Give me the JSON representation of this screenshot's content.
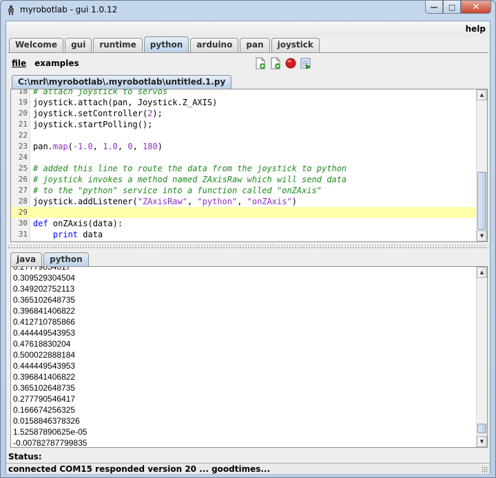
{
  "window": {
    "title": "myrobotlab - gui 1.0.12",
    "controls": {
      "minimize": "—",
      "maximize": "□",
      "close": "✕"
    }
  },
  "menubar": {
    "help": "help"
  },
  "main_tabs": [
    {
      "label": "Welcome",
      "active": false
    },
    {
      "label": "gui",
      "active": false
    },
    {
      "label": "runtime",
      "active": false
    },
    {
      "label": "python",
      "active": true
    },
    {
      "label": "arduino",
      "active": false
    },
    {
      "label": "pan",
      "active": false
    },
    {
      "label": "joystick",
      "active": false
    }
  ],
  "python_panel": {
    "menu": {
      "file": "file",
      "examples": "examples"
    },
    "toolbar": [
      "new-file-icon",
      "open-file-icon",
      "stop-icon",
      "execute-icon"
    ],
    "file_tab": "C:\\mrl\\myrobotlab\\.myrobotlab\\untitled.1.py",
    "editor": {
      "lines": [
        {
          "n": "18",
          "parts": [
            [
              "cm",
              "# attach joystick to servos"
            ]
          ]
        },
        {
          "n": "19",
          "parts": [
            [
              "",
              "joystick.attach(pan, Joystick.Z_AXIS)"
            ]
          ]
        },
        {
          "n": "20",
          "parts": [
            [
              "",
              "joystick.setController("
            ],
            [
              "num",
              "2"
            ],
            [
              "",
              ");"
            ]
          ]
        },
        {
          "n": "21",
          "parts": [
            [
              "",
              "joystick.startPolling();"
            ]
          ]
        },
        {
          "n": "22",
          "parts": []
        },
        {
          "n": "23",
          "parts": [
            [
              "",
              "pan."
            ],
            [
              "fn",
              "map"
            ],
            [
              "",
              "("
            ],
            [
              "num",
              "-1.0"
            ],
            [
              "",
              ", "
            ],
            [
              "num",
              "1.0"
            ],
            [
              "",
              ", "
            ],
            [
              "num",
              "0"
            ],
            [
              "",
              ", "
            ],
            [
              "num",
              "180"
            ],
            [
              "",
              ")"
            ]
          ]
        },
        {
          "n": "24",
          "parts": []
        },
        {
          "n": "25",
          "parts": [
            [
              "cm",
              "# added this line to route the data from the joystick to python"
            ]
          ]
        },
        {
          "n": "26",
          "parts": [
            [
              "cm",
              "# joystick invokes a method named ZAxisRaw which will send data"
            ]
          ]
        },
        {
          "n": "27",
          "parts": [
            [
              "cm",
              "# to the \"python\" service into a function called \"onZAxis\""
            ]
          ]
        },
        {
          "n": "28",
          "parts": [
            [
              "",
              "joystick.addListener("
            ],
            [
              "str",
              "\"ZAxisRaw\""
            ],
            [
              "",
              ", "
            ],
            [
              "str",
              "\"python\""
            ],
            [
              "",
              ", "
            ],
            [
              "str",
              "\"onZAxis\""
            ],
            [
              "",
              ")"
            ]
          ]
        },
        {
          "n": "29",
          "parts": [],
          "current": true
        },
        {
          "n": "30",
          "parts": [
            [
              "kw",
              "def"
            ],
            [
              "",
              " onZAxis(data):"
            ]
          ]
        },
        {
          "n": "31",
          "parts": [
            [
              "",
              "    "
            ],
            [
              "kw",
              "print"
            ],
            [
              "",
              " data"
            ]
          ]
        }
      ]
    }
  },
  "console_tabs": [
    {
      "label": "java",
      "active": false
    },
    {
      "label": "python",
      "active": true
    }
  ],
  "console": {
    "lines": [
      "0.27779054617",
      "0.309529304504",
      "0.349202752113",
      "0.365102648735",
      "0.396841406822",
      "0.412710785866",
      "0.444449543953",
      "0.47618830204",
      "0.500022888184",
      "0.444449543953",
      "0.396841406822",
      "0.365102648735",
      "0.277790546417",
      "0.166674256325",
      "0.0158846378326",
      "1.52587890625e-05",
      "-0.00782787799835"
    ]
  },
  "status": {
    "label": "Status:",
    "message": "connected COM15 responded version 20 ... goodtimes..."
  }
}
